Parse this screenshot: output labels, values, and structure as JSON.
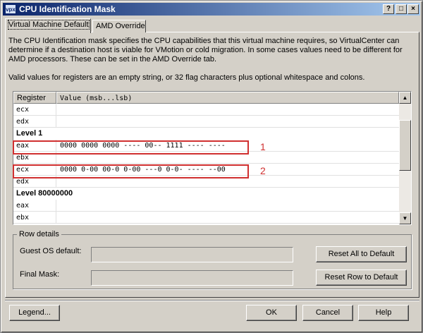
{
  "window": {
    "icon_text": "vpx",
    "title": "CPU Identification Mask",
    "controls": {
      "help": "?",
      "minimize": "_",
      "maximize": "□",
      "close": "×"
    }
  },
  "tabs": [
    {
      "label": "Virtual Machine Default",
      "active": true
    },
    {
      "label": "AMD Override",
      "active": false
    }
  ],
  "description": "The CPU Identification mask specifies the CPU capabilities that this virtual machine requires, so VirtualCenter can determine if a destination host is viable for VMotion or cold migration. In some cases values need to be different for AMD processors. These can be set in the AMD Override tab.",
  "valid_values": "Valid values for registers are an empty string, or 32 flag characters plus optional whitespace and colons.",
  "grid": {
    "columns": [
      "Register",
      "Value (msb...lsb)"
    ],
    "rows": [
      {
        "register": "ecx",
        "value": ""
      },
      {
        "register": "edx",
        "value": ""
      },
      {
        "level": "Level 1"
      },
      {
        "register": "eax",
        "value": "0000 0000 0000 ---- 00-- 1111 ---- ----"
      },
      {
        "register": "ebx",
        "value": ""
      },
      {
        "register": "ecx",
        "value": "0000 0-00 00-0 0-00 ---0 0-0- ---- --00"
      },
      {
        "register": "edx",
        "value": ""
      },
      {
        "level": "Level 80000000"
      },
      {
        "register": "eax",
        "value": ""
      },
      {
        "register": "ebx",
        "value": ""
      }
    ],
    "annotations": [
      "1",
      "2"
    ]
  },
  "row_details": {
    "label": "Row details",
    "guest_os_default_label": "Guest OS default:",
    "final_mask_label": "Final Mask:",
    "reset_all_button": "Reset All to Default",
    "reset_row_button": "Reset Row to Default"
  },
  "footer": {
    "legend_button": "Legend...",
    "ok_button": "OK",
    "cancel_button": "Cancel",
    "help_button": "Help"
  },
  "colors": {
    "annotation": "#d03030",
    "titlebar_start": "#0a246a",
    "titlebar_end": "#a6caf0"
  }
}
